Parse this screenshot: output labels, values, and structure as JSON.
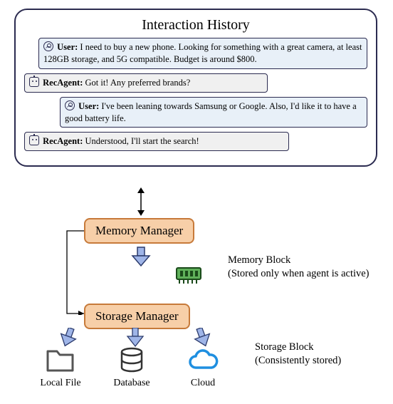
{
  "history": {
    "title": "Interaction History",
    "messages": [
      {
        "role_label": "User:",
        "text": "I need to buy a new phone. Looking for something with a great camera, at least 128GB storage, and 5G compatible. Budget is around $800."
      },
      {
        "role_label": "RecAgent:",
        "text": "Got it! Any preferred brands?"
      },
      {
        "role_label": "User:",
        "text": "I've been leaning towards Samsung or Google. Also, I'd like it to have a good battery life."
      },
      {
        "role_label": "RecAgent:",
        "text": "Understood, I'll start the search!"
      }
    ]
  },
  "managers": {
    "memory": "Memory Manager",
    "storage": "Storage Manager"
  },
  "memory_block": {
    "label_line1": "Memory Block",
    "label_line2": "(Stored only when agent is active)"
  },
  "storage_block": {
    "label_line1": "Storage Block",
    "label_line2": "(Consistently stored)"
  },
  "storage_targets": {
    "local": "Local File",
    "database": "Database",
    "cloud": "Cloud"
  }
}
